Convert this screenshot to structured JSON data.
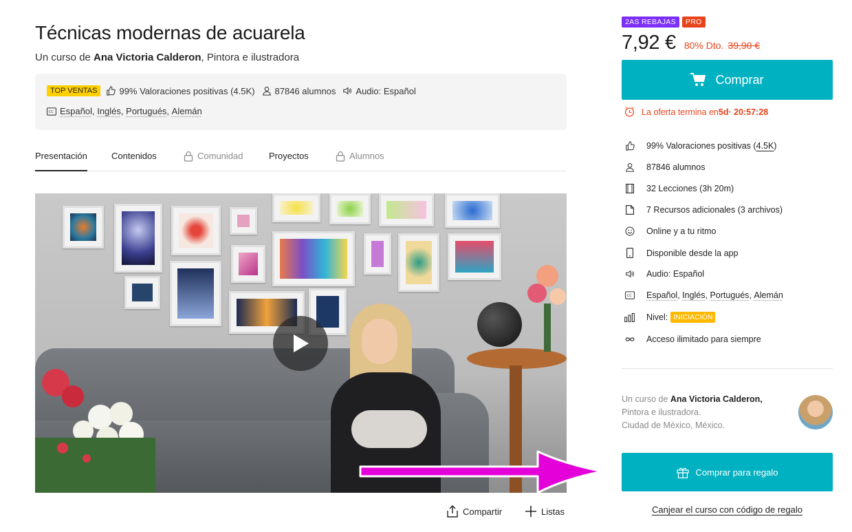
{
  "course": {
    "title": "Técnicas modernas de acuarela",
    "subtitle_prefix": "Un curso de ",
    "author_name": "Ana Victoria Calderon",
    "subtitle_suffix": ", Pintora e ilustradora"
  },
  "infobox": {
    "badge": "TOP VENTAS",
    "ratings": "99% Valoraciones positivas (4.5K)",
    "students": "87846 alumnos",
    "audio": "Audio: Español",
    "subs": [
      "Español",
      "Inglés",
      "Portugués",
      "Alemán"
    ]
  },
  "tabs": [
    {
      "label": "Presentación",
      "active": true,
      "locked": false
    },
    {
      "label": "Contenidos",
      "active": false,
      "locked": false
    },
    {
      "label": "Comunidad",
      "active": false,
      "locked": true
    },
    {
      "label": "Proyectos",
      "active": false,
      "locked": false
    },
    {
      "label": "Alumnos",
      "active": false,
      "locked": true
    }
  ],
  "actions": {
    "share": "Compartir",
    "lists": "Listas"
  },
  "pricing": {
    "label_sale": "2AS REBAJAS",
    "label_pro": "PRO",
    "price": "7,92 €",
    "discount": "80% Dto.",
    "old_price": "39,90 €",
    "buy": "Comprar",
    "offer_prefix": "La oferta termina en ",
    "offer_days": "5d",
    "offer_time": " · 20:57:28"
  },
  "features": {
    "ratings_prefix": "99% Valoraciones positivas (",
    "ratings_count": "4.5K",
    "ratings_suffix": ")",
    "students": "87846 alumnos",
    "lessons": "32 Lecciones (3h 20m)",
    "resources": "7 Recursos adicionales (3 archivos)",
    "online": "Online y a tu ritmo",
    "app": "Disponible desde la app",
    "audio": "Audio: Español",
    "subs": [
      "Español",
      "Inglés",
      "Portugués",
      "Alemán"
    ],
    "level_label": "Nivel:",
    "level_value": "INICIACIÓN",
    "access": "Acceso ilimitado para siempre"
  },
  "author": {
    "prefix": "Un curso de ",
    "name": "Ana Victoria Calderon,",
    "role": "Pintora e ilustradora.",
    "location": "Ciudad de México, México."
  },
  "gift": {
    "button": "Comprar para regalo",
    "redeem": "Canjear el curso con código de regalo"
  },
  "colors": {
    "accent": "#00b1c1",
    "sale": "#e8441b",
    "label_sale_bg": "#7b2ff7",
    "label_pro_bg": "#e8441b",
    "top_badge": "#ffd000",
    "level_badge": "#ffb800",
    "annotation_arrow": "#e400d8"
  }
}
